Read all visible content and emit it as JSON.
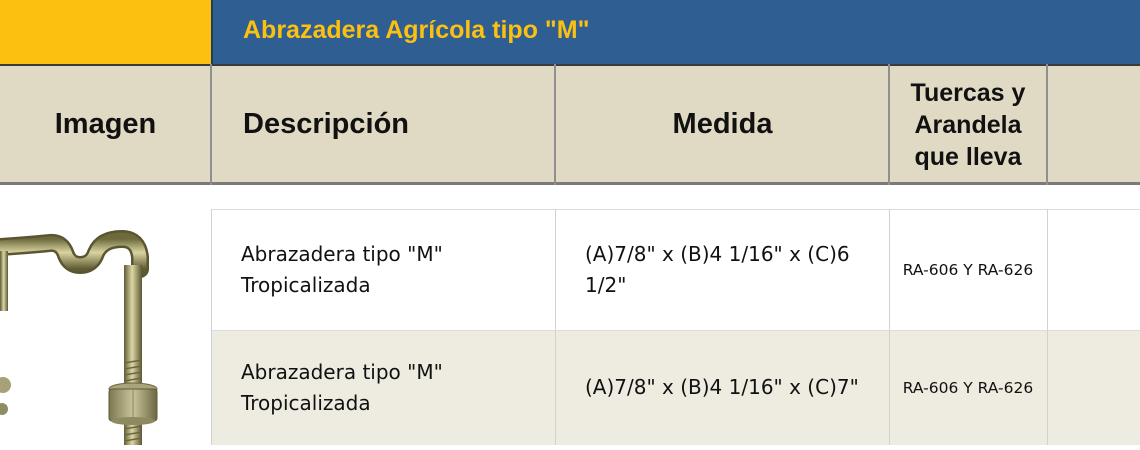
{
  "title": "Abrazadera Agrícola tipo \"M\"",
  "columns": {
    "imagen": "Imagen",
    "descripcion": "Descripción",
    "medida": "Medida",
    "tuercas_line1": "Tuercas y",
    "tuercas_line2": "Arandela",
    "tuercas_line3": "que lleva"
  },
  "rows": [
    {
      "desc_line1": "Abrazadera tipo \"M\"",
      "desc_line2": "Tropicalizada",
      "medida_line1": "(A)7/8\" x (B)4 1/16\" x (C)6",
      "medida_line2": "1/2\"",
      "tuercas": "RA-606 Y RA-626"
    },
    {
      "desc_line1": "Abrazadera tipo \"M\"",
      "desc_line2": "Tropicalizada",
      "medida_line1": "(A)7/8\" x (B)4 1/16\" x (C)7\"",
      "tuercas": "RA-606 Y RA-626"
    }
  ],
  "colors": {
    "title_bar": "#2F5E93",
    "title_text": "#FBC010",
    "header_bg": "#E0D9C3",
    "alt_row": "#EEEBE0"
  },
  "icons": {
    "product_image": "u-bolt-clamp"
  }
}
